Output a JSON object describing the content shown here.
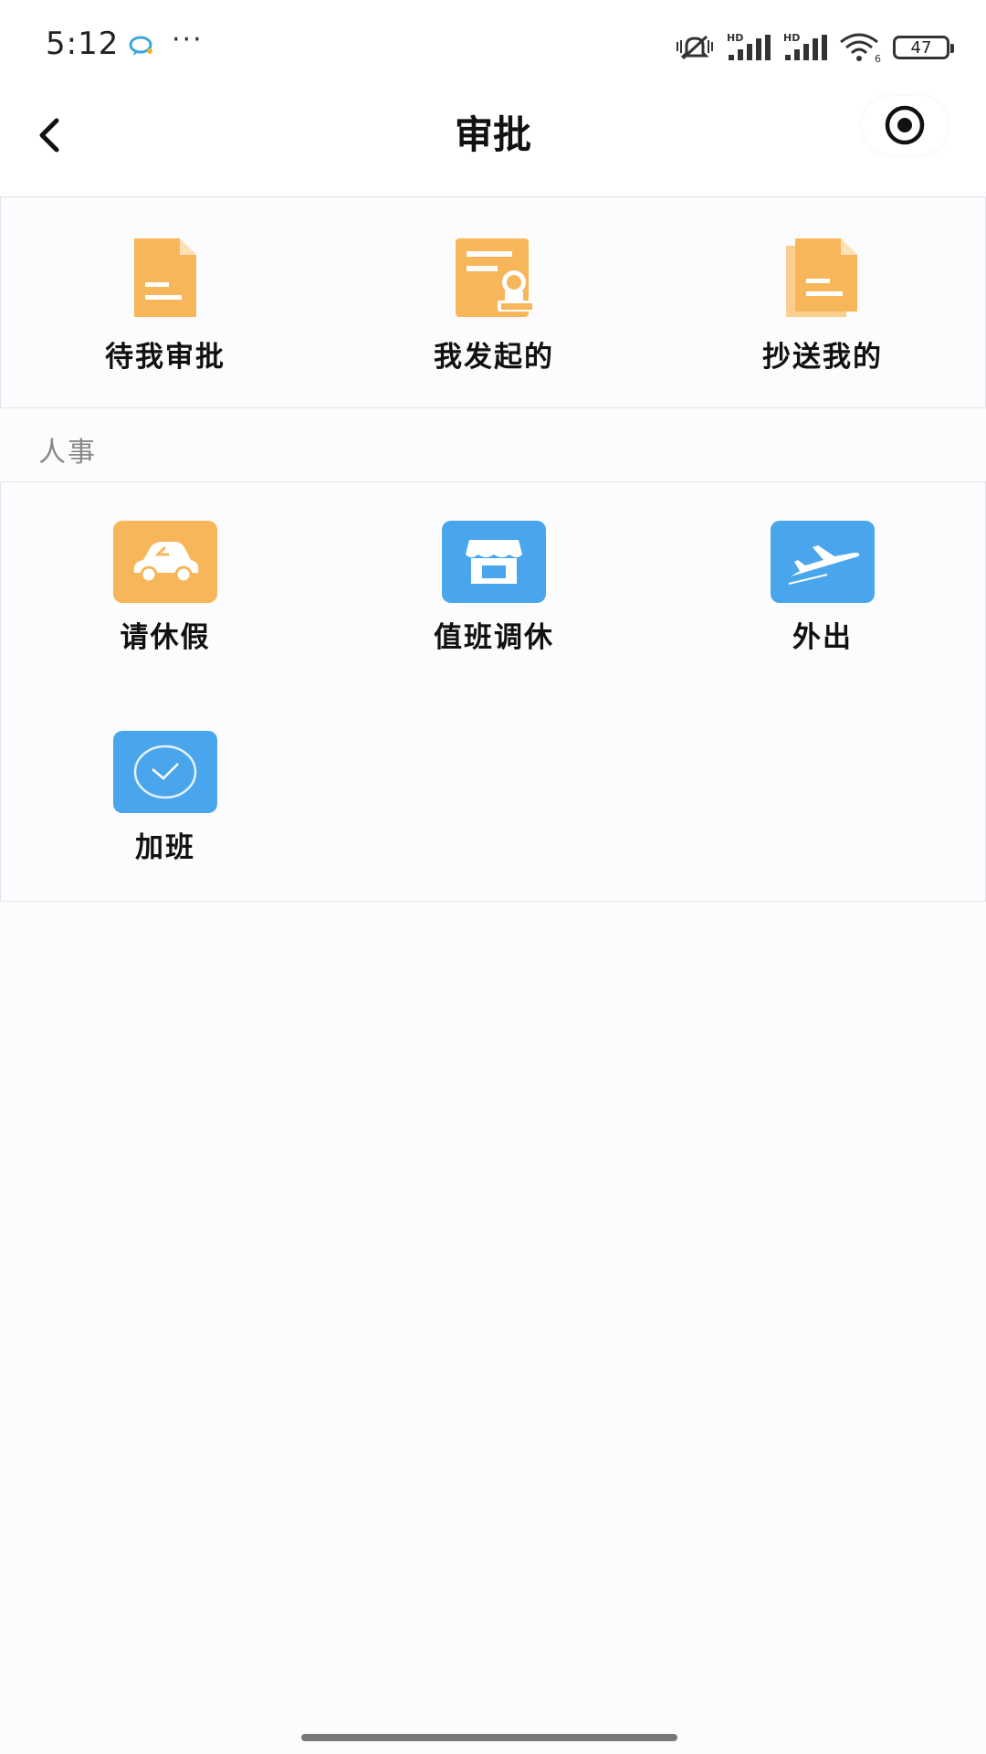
{
  "status_bar": {
    "time": "5:12",
    "more": "···",
    "battery": "47"
  },
  "header": {
    "title": "审批"
  },
  "quick_actions": [
    {
      "label": "待我审批",
      "icon": "document-icon"
    },
    {
      "label": "我发起的",
      "icon": "document-stamp-icon"
    },
    {
      "label": "抄送我的",
      "icon": "copied-documents-icon"
    }
  ],
  "hr_section": {
    "title": "人事",
    "items": [
      {
        "label": "请休假",
        "icon": "car-icon"
      },
      {
        "label": "值班调休",
        "icon": "store-icon"
      },
      {
        "label": "外出",
        "icon": "airplane-icon"
      },
      {
        "label": "加班",
        "icon": "clock-icon"
      }
    ]
  },
  "colors": {
    "orange": "#f8b65a",
    "blue": "#4aa6ec",
    "background": "#fcfbfd"
  }
}
